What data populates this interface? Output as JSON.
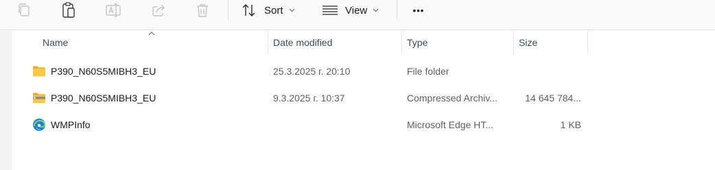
{
  "toolbar": {
    "sort_label": "Sort",
    "view_label": "View",
    "more_label": "•••"
  },
  "columns": {
    "name": "Name",
    "date_modified": "Date modified",
    "type": "Type",
    "size": "Size",
    "sorted_column": "name"
  },
  "files": [
    {
      "name": "P390_N60S5MIBH3_EU",
      "date": "25.3.2025 г. 20:10",
      "type": "File folder",
      "size": "",
      "icon": "folder-icon"
    },
    {
      "name": "P390_N60S5MIBH3_EU",
      "date": "9.3.2025 г. 10:37",
      "type": "Compressed Archiv...",
      "size": "14 645 784...",
      "icon": "zip-folder-icon"
    },
    {
      "name": "WMPInfo",
      "date": "",
      "type": "Microsoft Edge HT...",
      "size": "1 KB",
      "icon": "edge-icon"
    }
  ]
}
